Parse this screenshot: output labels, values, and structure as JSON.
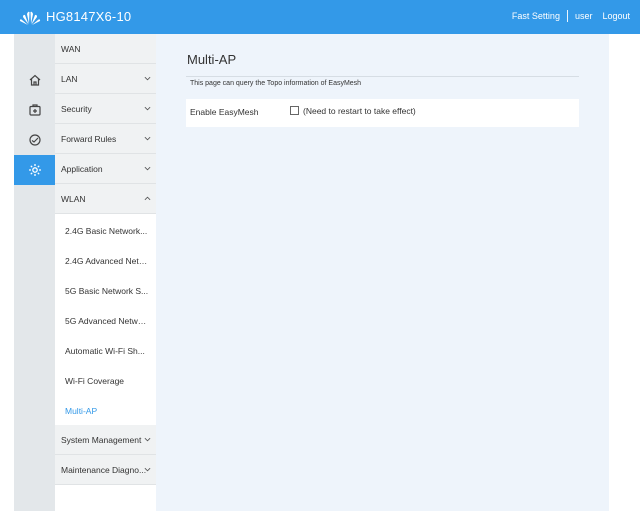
{
  "header": {
    "model": "HG8147X6-10",
    "links": [
      "Fast Setting",
      "user",
      "Logout"
    ],
    "logo_icon": "huawei-logo-icon"
  },
  "rail": {
    "icons": [
      "home-icon",
      "device-icon",
      "diagnostic-icon",
      "gear-icon"
    ],
    "active_index": 3
  },
  "menu": {
    "items": [
      {
        "label": "WAN",
        "expandable": false
      },
      {
        "label": "LAN",
        "expandable": true
      },
      {
        "label": "Security",
        "expandable": true
      },
      {
        "label": "Forward Rules",
        "expandable": true
      },
      {
        "label": "Application",
        "expandable": true
      },
      {
        "label": "WLAN",
        "expandable": true,
        "expanded": true
      }
    ],
    "wlan_sub": [
      {
        "label": "2.4G Basic Network..."
      },
      {
        "label": "2.4G Advanced Netw..."
      },
      {
        "label": "5G Basic Network S..."
      },
      {
        "label": "5G Advanced Networ..."
      },
      {
        "label": "Automatic Wi-Fi Sh..."
      },
      {
        "label": "Wi-Fi Coverage"
      },
      {
        "label": "Multi-AP",
        "active": true
      }
    ],
    "after": [
      {
        "label": "System Management",
        "expandable": true
      },
      {
        "label": "Maintenance Diagno...",
        "expandable": true
      }
    ]
  },
  "main": {
    "title": "Multi-AP",
    "description": "This page can query the Topo information of EasyMesh",
    "field_label": "Enable EasyMesh",
    "checkbox_note": "(Need to restart to take effect)",
    "checkbox_checked": false
  },
  "colors": {
    "accent": "#3399e8",
    "content_bg": "#eef4fb",
    "menu_bg": "#f0f2f3",
    "rail_bg": "#e3e7ea"
  }
}
